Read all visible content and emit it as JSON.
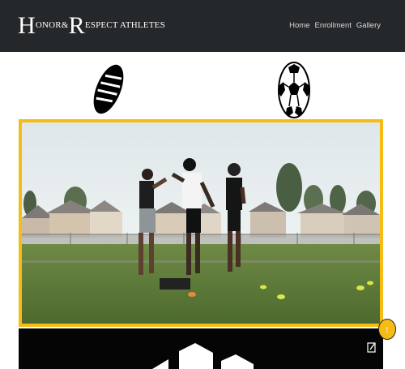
{
  "brand": {
    "first_initial": "H",
    "first_rest": "ONOR",
    "amp": "&",
    "second_initial": "R",
    "second_rest": "ESPECT ATHLETES"
  },
  "nav": {
    "items": [
      {
        "label": "Home"
      },
      {
        "label": "Enrollment"
      },
      {
        "label": "Gallery"
      }
    ]
  },
  "icons": {
    "football": "football-icon",
    "soccer": "soccer-ball-icon",
    "edit": "edit-icon",
    "scroll_top": "arrow-up-icon"
  },
  "scroll_top_glyph": "↑",
  "colors": {
    "navbar": "#25282b",
    "accent": "#f5bd14",
    "band": "#050505"
  }
}
